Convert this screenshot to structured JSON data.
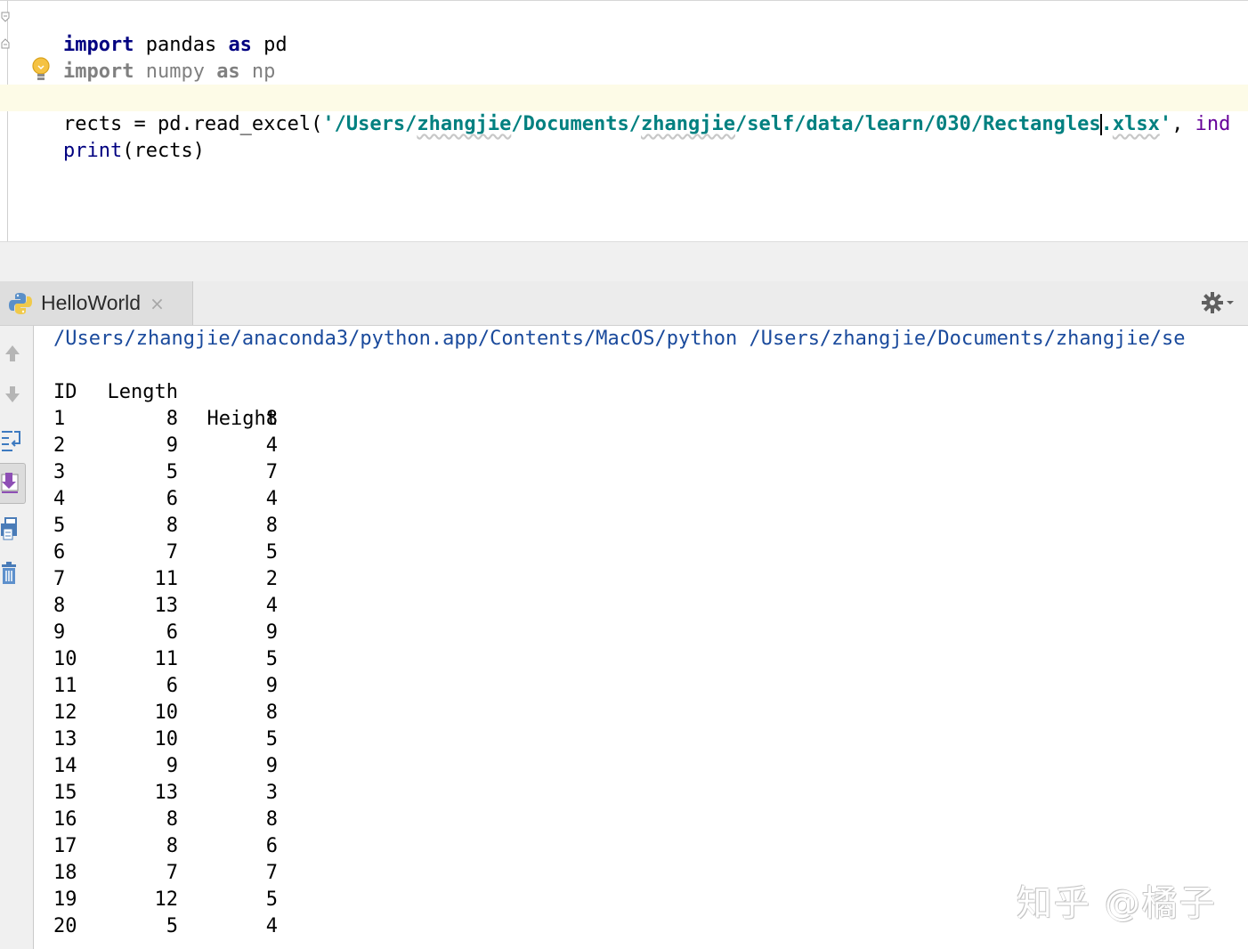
{
  "editor": {
    "line1": {
      "kw1": "import",
      "mod": " pandas ",
      "kw2": "as",
      "alias": " pd"
    },
    "line2": {
      "kw1": "import",
      "mod": " numpy ",
      "kw2": "as",
      "alias": " np"
    },
    "line4": {
      "var": "rects = pd.read_excel(",
      "str_a": "'/Users/",
      "str_b": "zhangjie",
      "str_c": "/Documents/",
      "str_d": "zhangjie",
      "str_e": "/self/data/learn/030/Rectangles",
      "str_f": ".",
      "str_g": "xlsx",
      "str_h": "'",
      "rest": ", ",
      "kwarg": "ind"
    },
    "line5": {
      "func": "print",
      "args": "(rects)"
    }
  },
  "run_panel": {
    "tab_label": "HelloWorld",
    "close_glyph": "×"
  },
  "console": {
    "command": "/Users/zhangjie/anaconda3/python.app/Contents/MacOS/python /Users/zhangjie/Documents/zhangjie/se",
    "header_length": "Length",
    "header_height": "Height",
    "index_name": "ID",
    "rows": [
      {
        "id": "1",
        "length": "8",
        "height": "8"
      },
      {
        "id": "2",
        "length": "9",
        "height": "4"
      },
      {
        "id": "3",
        "length": "5",
        "height": "7"
      },
      {
        "id": "4",
        "length": "6",
        "height": "4"
      },
      {
        "id": "5",
        "length": "8",
        "height": "8"
      },
      {
        "id": "6",
        "length": "7",
        "height": "5"
      },
      {
        "id": "7",
        "length": "11",
        "height": "2"
      },
      {
        "id": "8",
        "length": "13",
        "height": "4"
      },
      {
        "id": "9",
        "length": "6",
        "height": "9"
      },
      {
        "id": "10",
        "length": "11",
        "height": "5"
      },
      {
        "id": "11",
        "length": "6",
        "height": "9"
      },
      {
        "id": "12",
        "length": "10",
        "height": "8"
      },
      {
        "id": "13",
        "length": "10",
        "height": "5"
      },
      {
        "id": "14",
        "length": "9",
        "height": "9"
      },
      {
        "id": "15",
        "length": "13",
        "height": "3"
      },
      {
        "id": "16",
        "length": "8",
        "height": "8"
      },
      {
        "id": "17",
        "length": "8",
        "height": "6"
      },
      {
        "id": "18",
        "length": "7",
        "height": "7"
      },
      {
        "id": "19",
        "length": "12",
        "height": "5"
      },
      {
        "id": "20",
        "length": "5",
        "height": "4"
      }
    ]
  },
  "watermark": "知乎 @橘子",
  "icons": {
    "bulb": "lightbulb-icon",
    "python": "python-icon",
    "gear": "gear-icon",
    "toolbar": [
      "up-arrow-icon",
      "down-arrow-icon",
      "soft-wrap-icon",
      "scroll-to-end-icon",
      "print-icon",
      "trash-icon"
    ]
  },
  "colors": {
    "keyword": "#000080",
    "string": "#008080",
    "current_line": "#fdfbe7",
    "console_path": "#1a4a9c"
  }
}
